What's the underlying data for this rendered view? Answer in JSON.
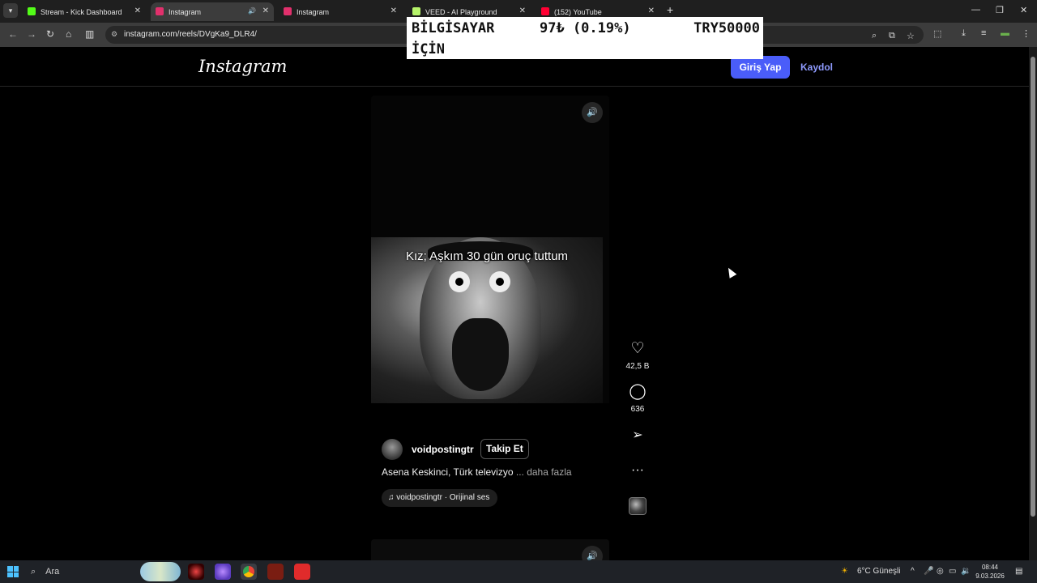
{
  "browser": {
    "tabs": [
      {
        "title": "Stream - Kick Dashboard",
        "active": false,
        "favicon_color": "#53fc18"
      },
      {
        "title": "Instagram",
        "active": true,
        "favicon_color": "#e1306c"
      },
      {
        "title": "Instagram",
        "active": false,
        "favicon_color": "#e1306c"
      },
      {
        "title": "VEED - AI Playground",
        "active": false,
        "favicon_color": "#b6f36a"
      },
      {
        "title": "(152) YouTube",
        "active": false,
        "favicon_color": "#ff0033"
      }
    ],
    "url": "instagram.com/reels/DVgKa9_DLR4/"
  },
  "overlay": {
    "line1": "BİLGİSAYAR",
    "line2": "İÇİN",
    "price": "97₺ (0.19%)",
    "target": "TRY50000"
  },
  "instagram": {
    "logo": "Instagram",
    "login_label": "Giriş Yap",
    "signup_label": "Kaydol",
    "accent_color": "#4a5df9"
  },
  "reel": {
    "caption_overlay": "Kız;  Aşkım 30 gün oruç tuttum",
    "username": "voidpostingtr",
    "follow_label": "Takip Et",
    "description": "Asena Keskinci, Türk televizyo",
    "more_label": "... daha fazla",
    "audio": "voidpostingtr · Orijinal ses",
    "likes": "42,5 B",
    "comments": "636"
  },
  "taskbar": {
    "search_placeholder": "Ara",
    "weather": "6°C  Güneşli",
    "time": "08:44",
    "date": "9.03.2026"
  }
}
